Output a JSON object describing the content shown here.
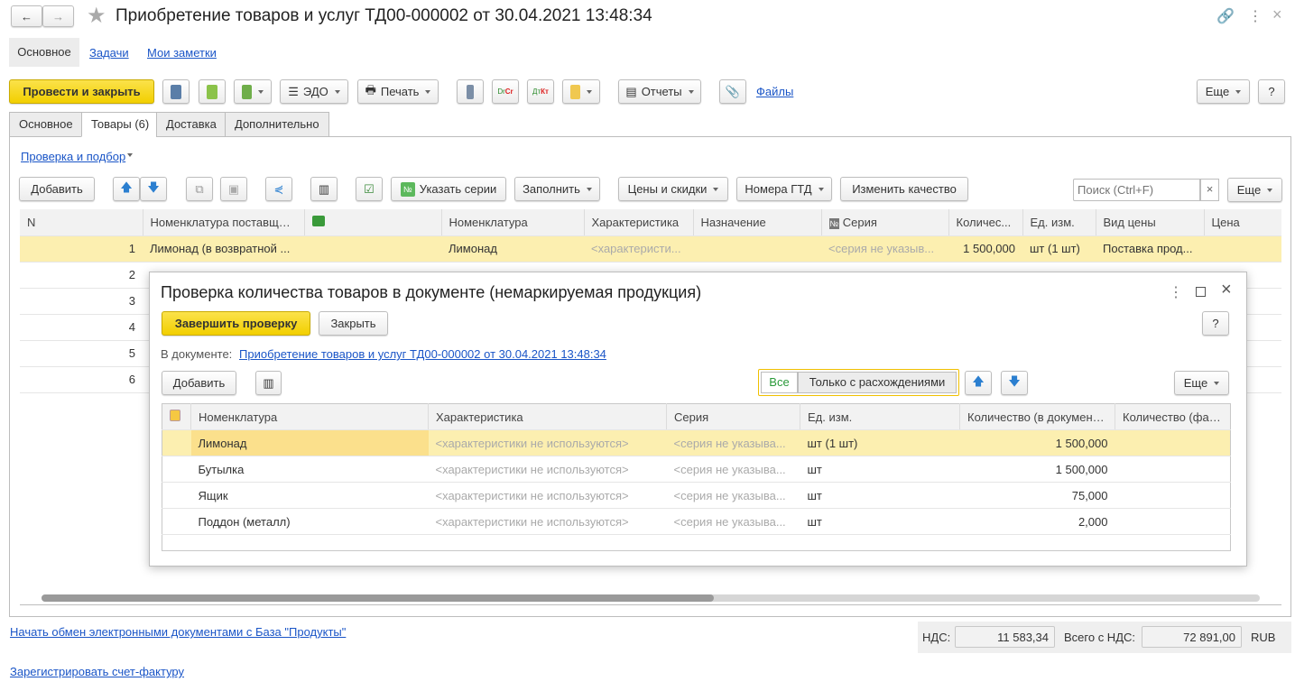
{
  "window": {
    "title": "Приобретение товаров и услуг ТД00-000002 от 30.04.2021 13:48:34"
  },
  "nav": {
    "items": [
      "Основное",
      "Задачи",
      "Мои заметки"
    ]
  },
  "toolbar": {
    "post_close": "Провести и закрыть",
    "edo": "ЭДО",
    "print": "Печать",
    "reports": "Отчеты",
    "files": "Файлы",
    "more": "Еще",
    "help": "?"
  },
  "tabs": [
    "Основное",
    "Товары (6)",
    "Доставка",
    "Дополнительно"
  ],
  "goods": {
    "check_link": "Проверка и подбор",
    "add": "Добавить",
    "series": "Указать серии",
    "fill": "Заполнить",
    "prices": "Цены и скидки",
    "gtd": "Номера ГТД",
    "quality": "Изменить качество",
    "search_placeholder": "Поиск (Ctrl+F)",
    "more": "Еще",
    "columns": [
      "N",
      "Номенклатура поставщика",
      "",
      "Номенклатура",
      "Характеристика",
      "Назначение",
      "Серия",
      "Количес...",
      "Ед. изм.",
      "Вид цены",
      "Цена"
    ],
    "rows": [
      {
        "n": "1",
        "supplier": "Лимонад (в возвратной ...",
        "item": "Лимонад",
        "char": "<характеристи...",
        "purpose": "",
        "series": "<серия не указыв...",
        "qty": "1 500,000",
        "unit": "шт (1 шт)",
        "price_type": "Поставка прод...",
        "price": ""
      },
      {
        "n": "2"
      },
      {
        "n": "3"
      },
      {
        "n": "4"
      },
      {
        "n": "5"
      },
      {
        "n": "6"
      }
    ]
  },
  "dialog": {
    "title": "Проверка количества товаров в документе (немаркируемая продукция)",
    "finish": "Завершить проверку",
    "close": "Закрыть",
    "help": "?",
    "doc_label": "В документе:",
    "doc_link": "Приобретение товаров и услуг ТД00-000002 от 30.04.2021 13:48:34",
    "add": "Добавить",
    "filter_all": "Все",
    "filter_diff": "Только с расхождениями",
    "more": "Еще",
    "columns": [
      "Номенклатура",
      "Характеристика",
      "Серия",
      "Ед. изм.",
      "Количество (в документе)",
      "Количество (факт)"
    ],
    "rows": [
      {
        "item": "Лимонад",
        "char": "<характеристики не используются>",
        "series": "<серия не указыва...",
        "unit": "шт (1 шт)",
        "qty_doc": "1 500,000",
        "qty_fact": ""
      },
      {
        "item": "Бутылка",
        "char": "<характеристики не используются>",
        "series": "<серия не указыва...",
        "unit": "шт",
        "qty_doc": "1 500,000",
        "qty_fact": ""
      },
      {
        "item": "Ящик",
        "char": "<характеристики не используются>",
        "series": "<серия не указыва...",
        "unit": "шт",
        "qty_doc": "75,000",
        "qty_fact": ""
      },
      {
        "item": "Поддон (металл)",
        "char": "<характеристики не используются>",
        "series": "<серия не указыва...",
        "unit": "шт",
        "qty_doc": "2,000",
        "qty_fact": ""
      }
    ]
  },
  "footer": {
    "edo_link": "Начать обмен электронными документами с База \"Продукты\"",
    "invoice_link": "Зарегистрировать счет-фактуру",
    "vat_label": "НДС:",
    "vat": "11 583,34",
    "total_label": "Всего с НДС:",
    "total": "72 891,00",
    "currency": "RUB"
  },
  "colors": {
    "accent": "#f2cf00",
    "link": "#1a55c7",
    "selected_row": "#fcefb0"
  }
}
